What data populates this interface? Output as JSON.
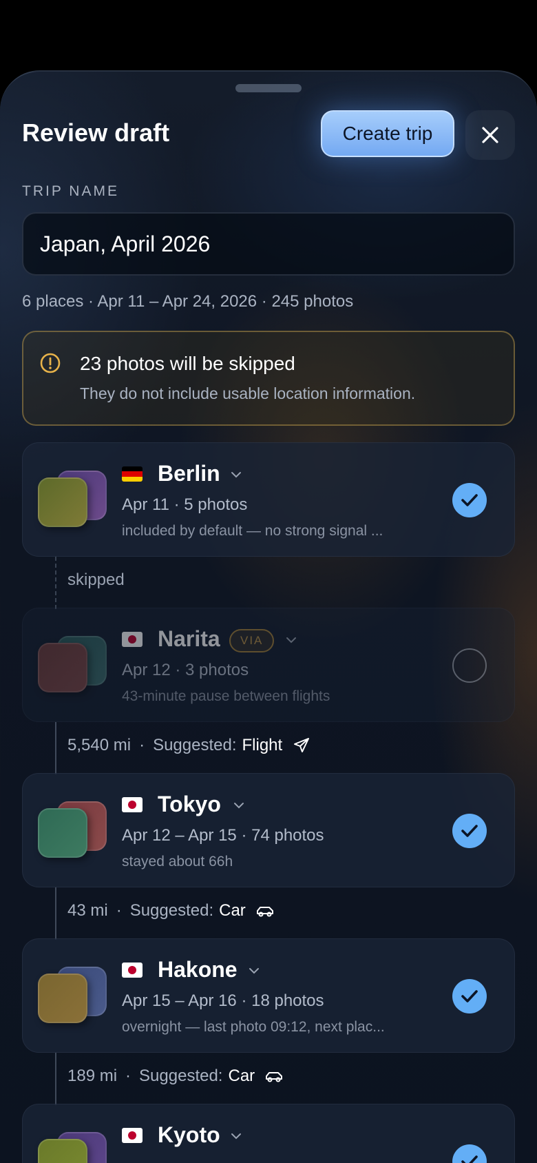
{
  "header": {
    "title": "Review draft",
    "create_label": "Create trip",
    "close_icon": "close-icon"
  },
  "trip_name": {
    "label": "TRIP NAME",
    "value": "Japan, April 2026"
  },
  "summary": "6 places · Apr 11 – Apr 24, 2026 · 245 photos",
  "warning": {
    "title": "23 photos will be skipped",
    "message": "They do not include usable location information.",
    "icon": "alert-circle-icon",
    "color": "#e8b34a"
  },
  "places": [
    {
      "name": "Berlin",
      "flag": "de",
      "dates": "Apr 11 · 5 photos",
      "note": "included by default — no strong signal ...",
      "selected": true
    },
    {
      "name": "Narita",
      "flag": "jp",
      "badge": "VIA",
      "dates": "Apr 12 · 3 photos",
      "note": "43-minute pause between flights",
      "selected": false
    },
    {
      "name": "Tokyo",
      "flag": "jp",
      "dates": "Apr 12 – Apr 15 · 74 photos",
      "note": "stayed about 66h",
      "selected": true
    },
    {
      "name": "Hakone",
      "flag": "jp",
      "dates": "Apr 15 – Apr 16 · 18 photos",
      "note": "overnight — last photo 09:12, next plac...",
      "selected": true
    },
    {
      "name": "Kyoto",
      "flag": "jp",
      "dates": "",
      "note": "",
      "selected": true
    }
  ],
  "segments": [
    {
      "status": "skipped"
    },
    {
      "distance": "5,540 mi",
      "dot": "·",
      "suggested": "Suggested:",
      "mode": "Flight",
      "icon": "airplane-icon"
    },
    {
      "distance": "43 mi",
      "dot": "·",
      "suggested": "Suggested:",
      "mode": "Car",
      "icon": "car-icon"
    },
    {
      "distance": "189 mi",
      "dot": "·",
      "suggested": "Suggested:",
      "mode": "Car",
      "icon": "car-icon"
    }
  ],
  "colors": {
    "accent": "#63aef6",
    "warning": "#e8b34a"
  }
}
